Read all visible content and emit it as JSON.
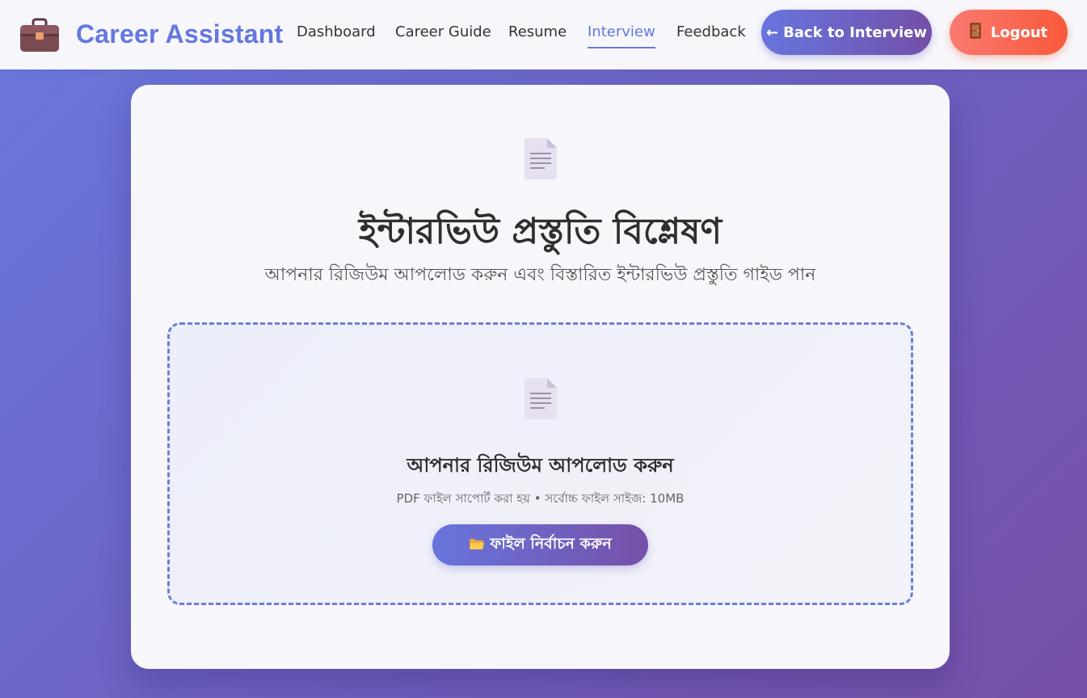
{
  "brand": {
    "name": "Career Assistant",
    "icon": "briefcase-icon"
  },
  "nav": {
    "links": [
      {
        "label": "Dashboard"
      },
      {
        "label": "Career Guide"
      },
      {
        "label": "Resume"
      },
      {
        "label": "Interview",
        "active": true
      },
      {
        "label": "Feedback"
      }
    ],
    "back_button": {
      "arrow": "←",
      "label": "Back to Interview"
    },
    "logout_button": {
      "icon": "door-icon",
      "label": "Logout"
    }
  },
  "main": {
    "header_icon": "document-icon",
    "title": "ইন্টারভিউ প্রস্তুতি বিশ্লেষণ",
    "subtitle": "আপনার রিজিউম আপলোড করুন এবং বিস্তারিত ইন্টারভিউ প্রস্তুতি গাইড পান",
    "upload": {
      "icon": "document-icon",
      "title": "আপনার রিজিউম আপলোড করুন",
      "hint": "PDF ফাইল সাপোর্ট করা হয় • সর্বোচ্চ ফাইল সাইজ: 10MB",
      "button_icon": "folder-icon",
      "button_label": "ফাইল নির্বাচন করুন"
    }
  },
  "colors": {
    "accent": "#6478e0",
    "gradient_start": "#6775dd",
    "gradient_end": "#7650a8",
    "logout_start": "#fb7a70",
    "logout_end": "#f7593a"
  }
}
